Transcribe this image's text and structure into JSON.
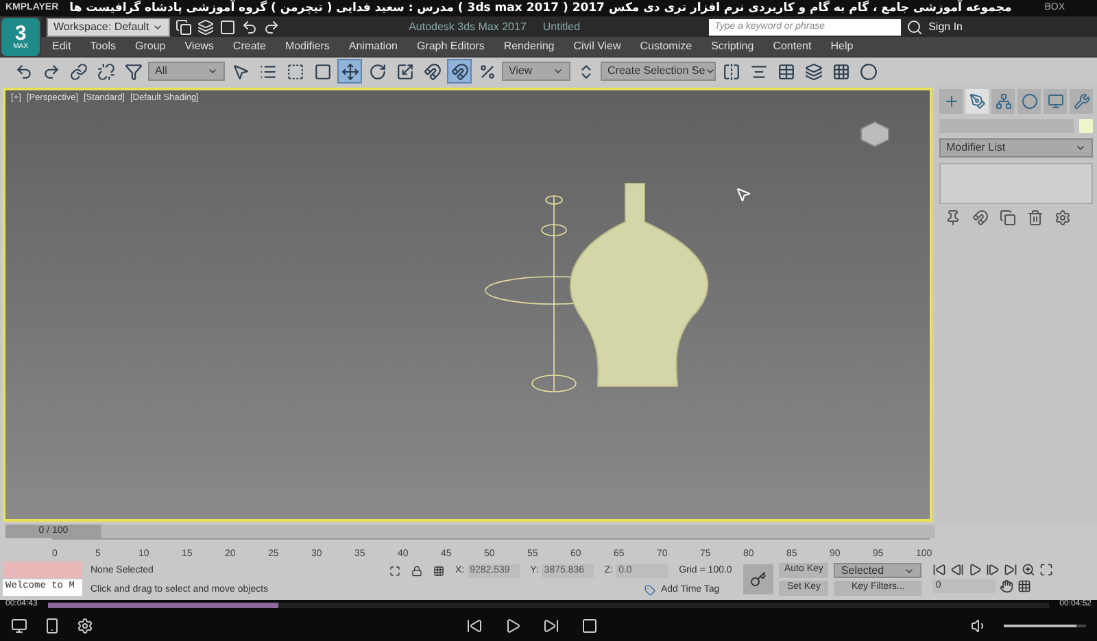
{
  "player": {
    "name": "KMPLAYER",
    "video_title": "مجموعه آموزشی جامع ، گام به گام و کاربردی نرم افزار تری دی مکس 2017 ( 3ds max 2017 ) مدرس : سعید فدایی ( تیچرمن ) گروه آموزشی پادشاه گرافیست ها",
    "badge": "BOX"
  },
  "app": {
    "logo": "3",
    "logo_sub": "MAX",
    "workspace": "Workspace: Default",
    "title": "Autodesk 3ds Max 2017",
    "document": "Untitled",
    "search": {
      "placeholder": "Type a keyword or phrase"
    },
    "sign_in": "Sign In"
  },
  "menu": [
    "Edit",
    "Tools",
    "Group",
    "Views",
    "Create",
    "Modifiers",
    "Animation",
    "Graph Editors",
    "Rendering",
    "Civil View",
    "Customize",
    "Scripting",
    "Content",
    "Help"
  ],
  "toolbar": {
    "selection_filter": "All",
    "coord_system": "View",
    "selection_set": "Create Selection Se",
    "buttons": [
      {
        "kind": "undo",
        "active": false
      },
      {
        "kind": "redo",
        "active": false
      },
      {
        "kind": "link",
        "active": false
      },
      {
        "kind": "unlink",
        "active": false
      },
      {
        "kind": "filter",
        "active": false
      },
      {
        "kind": "select",
        "active": false
      },
      {
        "kind": "list",
        "active": false
      },
      {
        "kind": "region",
        "active": false
      },
      {
        "kind": "window",
        "active": false
      },
      {
        "kind": "move",
        "active": true
      },
      {
        "kind": "rotate",
        "active": false
      },
      {
        "kind": "scale",
        "active": false
      },
      {
        "kind": "snap",
        "active": false
      },
      {
        "kind": "snap",
        "active": true
      },
      {
        "kind": "percent",
        "active": false
      },
      {
        "kind": "spinner",
        "active": false
      },
      {
        "kind": "mirror",
        "active": false
      },
      {
        "kind": "align",
        "active": false
      },
      {
        "kind": "table",
        "active": false
      },
      {
        "kind": "layers",
        "active": false
      },
      {
        "kind": "grid",
        "active": false
      },
      {
        "kind": "render",
        "active": false
      }
    ]
  },
  "viewport": {
    "labels": [
      "[+]",
      "[Perspective]",
      "[Standard]",
      "[Default Shading]"
    ]
  },
  "command_panel": {
    "tabs": [
      {
        "kind": "create",
        "selected": false
      },
      {
        "kind": "modify",
        "selected": true
      },
      {
        "kind": "hierarchy",
        "selected": false
      },
      {
        "kind": "motion",
        "selected": false
      },
      {
        "kind": "display",
        "selected": false
      },
      {
        "kind": "utilities",
        "selected": false
      }
    ],
    "modifier_list": "Modifier List"
  },
  "timeline": {
    "frame": "0 / 100",
    "level": 0,
    "ruler": [
      "0",
      "5",
      "10",
      "15",
      "20",
      "25",
      "30",
      "35",
      "40",
      "45",
      "50",
      "55",
      "60",
      "65",
      "70",
      "75",
      "80",
      "85",
      "90",
      "95",
      "100"
    ]
  },
  "status": {
    "listener": "Welcome to M",
    "selection": "None Selected",
    "prompt": "Click and drag to select and move objects",
    "coords": [
      {
        "label": "X:",
        "value": "9282.539"
      },
      {
        "label": "Y:",
        "value": "3875.836"
      },
      {
        "label": "Z:",
        "value": "0.0"
      }
    ],
    "grid": "Grid = 100.0",
    "time_tag": "Add Time Tag",
    "auto_key": "Auto Key",
    "set_key": "Set Key",
    "key_mode": "Selected",
    "key_filters": "Key Filters...",
    "frame": "0"
  },
  "playback": {
    "elapsed": "00:04:43",
    "total": "00:04:52",
    "level": 0.23,
    "volume": {
      "level": 0.88
    }
  }
}
